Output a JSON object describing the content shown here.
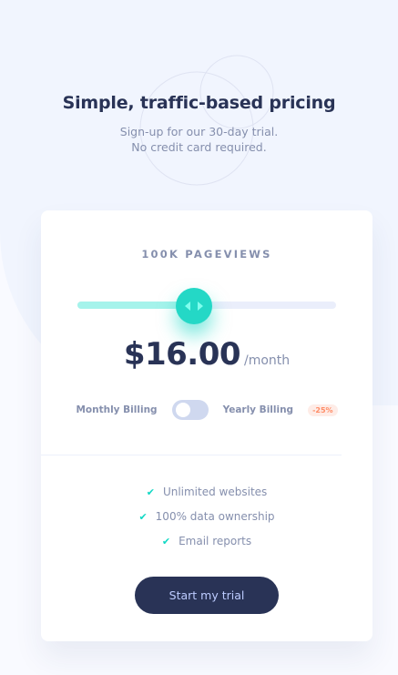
{
  "header": {
    "title": "Simple, traffic-based pricing",
    "subtitle": "Sign-up for our 30-day trial. No credit card required."
  },
  "pricing": {
    "pageviews_label": "100K PAGEVIEWS",
    "slider_value_percent": 45,
    "price": "$16.00",
    "period": "/month",
    "billing": {
      "monthly_label": "Monthly Billing",
      "yearly_label": "Yearly Billing",
      "discount_badge": "-25%",
      "yearly_enabled": false
    },
    "features": [
      "Unlimited websites",
      "100% data ownership",
      "Email reports"
    ],
    "check_icon": "✔",
    "cta_label": "Start my trial"
  },
  "colors": {
    "accent": "#10d8c4",
    "slider_fill": "#a5f3eb",
    "navy": "#293356",
    "text_muted": "#858fad",
    "discount_bg": "#feece7",
    "discount_text": "#ff8c66"
  }
}
